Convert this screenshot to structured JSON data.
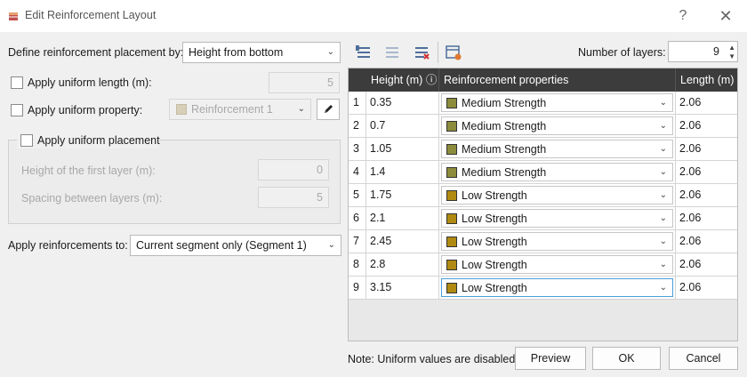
{
  "window": {
    "title": "Edit Reinforcement Layout",
    "help": "?",
    "close": "✕"
  },
  "left": {
    "placement_label": "Define reinforcement placement by:",
    "placement_value": "Height from bottom",
    "uniform_length_label": "Apply uniform length (m):",
    "uniform_length_value": "5",
    "uniform_property_label": "Apply uniform property:",
    "uniform_property_value": "Reinforcement 1",
    "uniform_placement_label": "Apply uniform placement",
    "first_layer_label": "Height of the first layer (m):",
    "first_layer_value": "0",
    "spacing_label": "Spacing between layers (m):",
    "spacing_value": "5",
    "apply_to_label": "Apply reinforcements to:",
    "apply_to_value": "Current segment only (Segment 1)"
  },
  "toolbar": {
    "layers_label": "Number of layers:",
    "layers_value": "9"
  },
  "table": {
    "headers": {
      "height": "Height (m) ⓘ",
      "props": "Reinforcement properties",
      "length": "Length (m)"
    },
    "rows": [
      {
        "idx": "1",
        "height": "0.35",
        "prop": "Medium Strength",
        "color": "#8c8c3c",
        "length": "2.06"
      },
      {
        "idx": "2",
        "height": "0.7",
        "prop": "Medium Strength",
        "color": "#8c8c3c",
        "length": "2.06"
      },
      {
        "idx": "3",
        "height": "1.05",
        "prop": "Medium Strength",
        "color": "#8c8c3c",
        "length": "2.06"
      },
      {
        "idx": "4",
        "height": "1.4",
        "prop": "Medium Strength",
        "color": "#8c8c3c",
        "length": "2.06"
      },
      {
        "idx": "5",
        "height": "1.75",
        "prop": "Low Strength",
        "color": "#b08a12",
        "length": "2.06"
      },
      {
        "idx": "6",
        "height": "2.1",
        "prop": "Low Strength",
        "color": "#b08a12",
        "length": "2.06"
      },
      {
        "idx": "7",
        "height": "2.45",
        "prop": "Low Strength",
        "color": "#b08a12",
        "length": "2.06"
      },
      {
        "idx": "8",
        "height": "2.8",
        "prop": "Low Strength",
        "color": "#b08a12",
        "length": "2.06"
      },
      {
        "idx": "9",
        "height": "3.15",
        "prop": "Low Strength",
        "color": "#b08a12",
        "length": "2.06"
      }
    ]
  },
  "footer": {
    "note": "Note: Uniform values are disabled.",
    "preview": "Preview",
    "ok": "OK",
    "cancel": "Cancel"
  },
  "colors": {
    "header_bg": "#3c3c3c",
    "medium_swatch": "#8c8c3c",
    "low_swatch": "#b08a12",
    "focus": "#4a9fd8"
  }
}
